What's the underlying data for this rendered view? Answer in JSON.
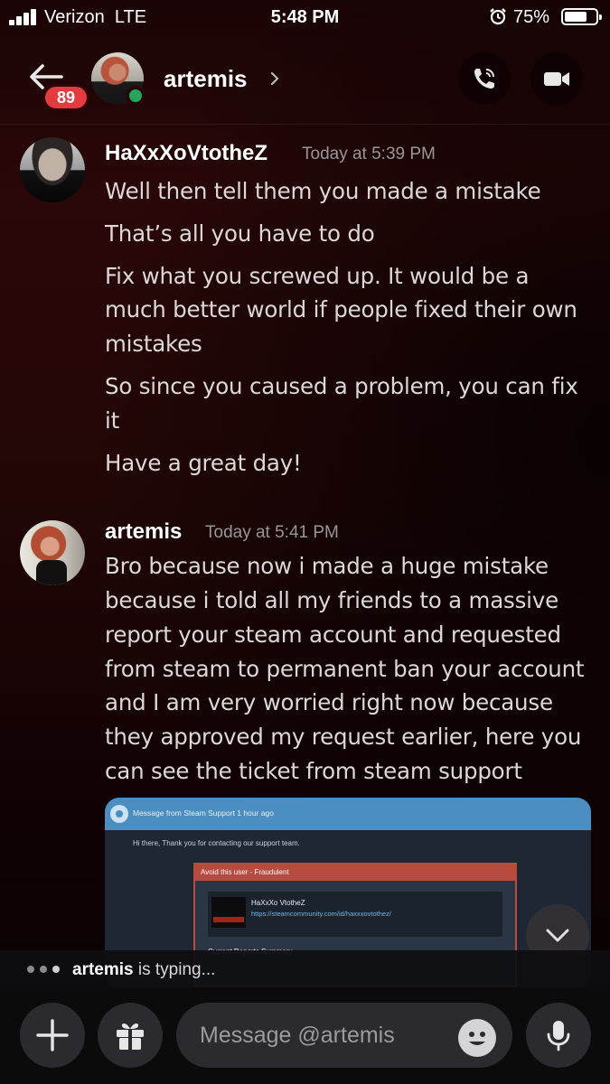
{
  "status_bar": {
    "carrier": "Verizon",
    "network": "LTE",
    "time": "5:48 PM",
    "battery_percent": "75%",
    "battery_level": 0.75,
    "signal_bars": 4
  },
  "header": {
    "unread_count": "89",
    "contact_name": "artemis",
    "presence": "online",
    "icons": [
      "back-arrow-icon",
      "chevron-right-icon",
      "phone-icon",
      "video-camera-icon"
    ]
  },
  "messages": [
    {
      "author": "HaXxXoVtotheZ",
      "timestamp": "Today at 5:39 PM",
      "lines": [
        "Well then tell them you made a mistake",
        "That’s all you have to do",
        "Fix what you screwed up. It would be a",
        "much better world if people fixed their own",
        "mistakes",
        "So since you caused a problem, you can fix",
        "it",
        "Have a great day!"
      ]
    },
    {
      "author": "artemis",
      "timestamp": "Today at 5:41 PM",
      "lines": [
        "Bro because now i made a huge mistake",
        "because i told all my friends to a massive",
        "report your steam account and requested",
        "from steam to permanent ban your account",
        "and I am very worried right now because",
        "they approved my request earlier, here you",
        "can see the ticket from steam support"
      ]
    }
  ],
  "attachment": {
    "header_text": "Message from Steam Support 1 hour ago",
    "greeting": "Hi there, Thank you for contacting our support team.",
    "card_title": "Avoid this user - Fraudulent",
    "profile_name": "HaXxXo VtotheZ",
    "profile_url": "https://steamcommunity.com/id/haxxxovtothez/",
    "section_title": "Current Reports Summary"
  },
  "typing": {
    "user": "artemis",
    "text": "is typing..."
  },
  "composer": {
    "placeholder": "Message @artemis",
    "icons": [
      "plus-icon",
      "gift-icon",
      "emoji-icon",
      "microphone-icon"
    ]
  },
  "colors": {
    "badge": "#e53a3e",
    "online": "#23a55a",
    "background_top": "#2a0708",
    "steam_header": "#4a8ec2",
    "report_red": "#b84a3e"
  }
}
